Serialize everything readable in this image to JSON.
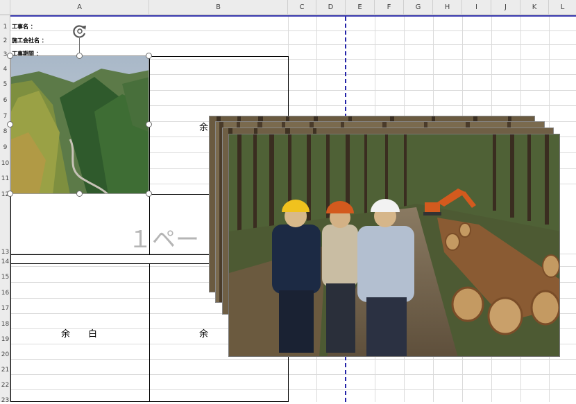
{
  "columns": [
    "A",
    "B",
    "C",
    "D",
    "E",
    "F",
    "G",
    "H",
    "I",
    "J",
    "K",
    "L"
  ],
  "rows": [
    "1",
    "2",
    "3",
    "4",
    "5",
    "6",
    "7",
    "8",
    "9",
    "10",
    "11",
    "12",
    "13",
    "14",
    "15",
    "16",
    "17",
    "18",
    "19",
    "20",
    "21",
    "22",
    "23"
  ],
  "cells": {
    "project_name_label": "工事名 ：",
    "contractor_label": "施工会社名 ：",
    "period_label": "工事期間 ："
  },
  "yohaku": {
    "b7": "余",
    "a18": "余　　白",
    "b18": "余"
  },
  "page_watermark": "１ペー",
  "photos": {
    "forest": "aerial-forest-valley-photo",
    "workers": "forestry-workers-log-pile-photo"
  },
  "colors": {
    "page_break": "#2323a8",
    "header_bg": "#ececec",
    "gridline": "#dadada"
  }
}
